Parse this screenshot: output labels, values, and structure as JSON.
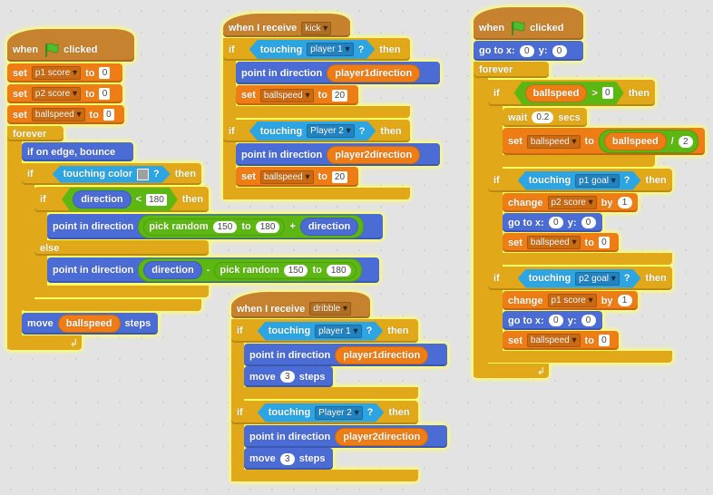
{
  "colors": {
    "events": "#c6822f",
    "data": "#ee7d16",
    "motion": "#4a6cd4",
    "control": "#e1a91a",
    "sensing": "#2ca5e2",
    "operators": "#5cb712",
    "touch_color_swatch": "#a0a0a0",
    "glow": "#ffff55"
  },
  "s1": {
    "hat": {
      "when": "when",
      "icon": "green-flag-icon",
      "clicked": "clicked"
    },
    "set1": {
      "set": "set",
      "var": "p1 score",
      "to": "to",
      "val": "0"
    },
    "set2": {
      "set": "set",
      "var": "p2 score",
      "to": "to",
      "val": "0"
    },
    "set3": {
      "set": "set",
      "var": "ballspeed",
      "to": "to",
      "val": "0"
    },
    "forever": "forever",
    "bounce": "if on edge, bounce",
    "if1": {
      "if": "if",
      "touching": "touching color",
      "q": "?",
      "then": "then"
    },
    "if2": {
      "if": "if",
      "var": "direction",
      "op": "<",
      "val": "180",
      "then": "then"
    },
    "point1": {
      "label": "point in direction",
      "pick": "pick random",
      "a": "150",
      "to": "to",
      "b": "180",
      "plus": "+",
      "var": "direction"
    },
    "else": "else",
    "point2": {
      "label": "point in direction",
      "var": "direction",
      "minus": "-",
      "pick": "pick random",
      "a": "150",
      "to": "to",
      "b": "180"
    },
    "move": {
      "move": "move",
      "var": "ballspeed",
      "steps": "steps"
    }
  },
  "s2": {
    "hat": {
      "label": "when I receive",
      "msg": "kick"
    },
    "if1": {
      "if": "if",
      "touching": "touching",
      "obj": "player 1",
      "q": "?",
      "then": "then"
    },
    "point1": {
      "label": "point in direction",
      "var": "player1direction"
    },
    "set1": {
      "set": "set",
      "var": "ballspeed",
      "to": "to",
      "val": "20"
    },
    "if2": {
      "if": "if",
      "touching": "touching",
      "obj": "Player 2",
      "q": "?",
      "then": "then"
    },
    "point2": {
      "label": "point in direction",
      "var": "player2direction"
    },
    "set2": {
      "set": "set",
      "var": "ballspeed",
      "to": "to",
      "val": "20"
    }
  },
  "s3": {
    "hat": {
      "label": "when I receive",
      "msg": "dribble"
    },
    "if1": {
      "if": "if",
      "touching": "touching",
      "obj": "player 1",
      "q": "?",
      "then": "then"
    },
    "point1": {
      "label": "point in direction",
      "var": "player1direction"
    },
    "move1": {
      "move": "move",
      "val": "3",
      "steps": "steps"
    },
    "if2": {
      "if": "if",
      "touching": "touching",
      "obj": "Player 2",
      "q": "?",
      "then": "then"
    },
    "point2": {
      "label": "point in direction",
      "var": "player2direction"
    },
    "move2": {
      "move": "move",
      "val": "3",
      "steps": "steps"
    }
  },
  "s4": {
    "hat": {
      "when": "when",
      "icon": "green-flag-icon",
      "clicked": "clicked"
    },
    "goto": {
      "goto": "go to x:",
      "x": "0",
      "y": "y:",
      "yv": "0"
    },
    "forever": "forever",
    "if1": {
      "if": "if",
      "var": "ballspeed",
      "op": ">",
      "val": "0",
      "then": "then"
    },
    "wait": {
      "wait": "wait",
      "val": "0.2",
      "secs": "secs"
    },
    "set1": {
      "set": "set",
      "var": "ballspeed",
      "to": "to",
      "rvar": "ballspeed",
      "div": "/",
      "val": "2"
    },
    "if2": {
      "if": "if",
      "touching": "touching",
      "obj": "p1 goal",
      "q": "?",
      "then": "then"
    },
    "change1": {
      "change": "change",
      "var": "p2 score",
      "by": "by",
      "val": "1"
    },
    "goto1": {
      "goto": "go to x:",
      "x": "0",
      "y": "y:",
      "yv": "0"
    },
    "set2": {
      "set": "set",
      "var": "ballspeed",
      "to": "to",
      "val": "0"
    },
    "if3": {
      "if": "if",
      "touching": "touching",
      "obj": "p2 goal",
      "q": "?",
      "then": "then"
    },
    "change2": {
      "change": "change",
      "var": "p1 score",
      "by": "by",
      "val": "1"
    },
    "goto2": {
      "goto": "go to x:",
      "x": "0",
      "y": "y:",
      "yv": "0"
    },
    "set3": {
      "set": "set",
      "var": "ballspeed",
      "to": "to",
      "val": "0"
    }
  }
}
